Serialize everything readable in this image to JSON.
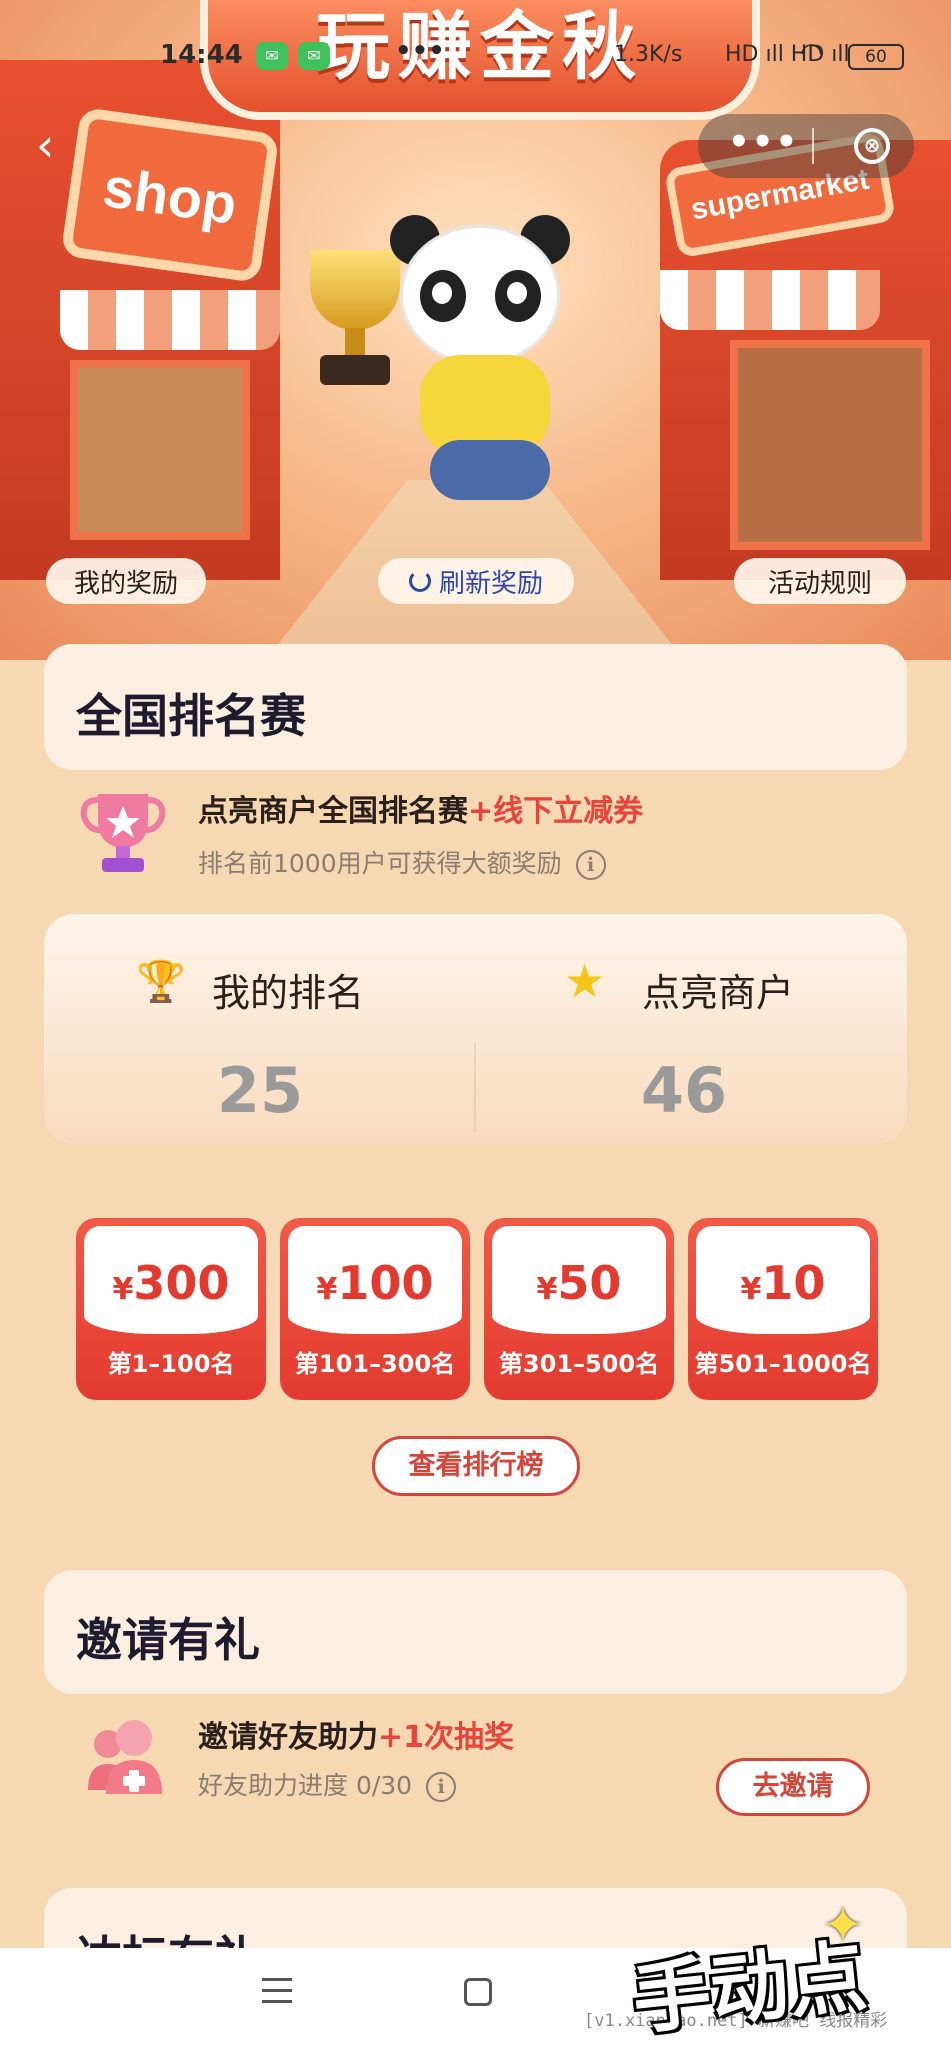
{
  "status_bar": {
    "time": "14:44",
    "more_dots": "•••",
    "net_speed": "1.3K/s",
    "signal": "HD ıll HD ıll",
    "battery": "60"
  },
  "hero": {
    "banner_title": "玩赚金秋",
    "shop_sign_left": "shop",
    "shop_sign_right": "supermarket",
    "my_rewards": "我的奖励",
    "refresh_rewards": "刷新奖励",
    "activity_rules": "活动规则"
  },
  "ranking_section": {
    "title": "全国排名赛",
    "row_main": "点亮商户全国排名赛",
    "row_highlight": "+线下立减券",
    "row_sub": "排名前1000用户可获得大额奖励",
    "my_rank_label": "我的排名",
    "my_rank_value": "25",
    "merchants_label": "点亮商户",
    "merchants_value": "46",
    "rewards": [
      {
        "amount": "300",
        "range": "第1–100名"
      },
      {
        "amount": "100",
        "range": "第101–300名"
      },
      {
        "amount": "50",
        "range": "第301–500名"
      },
      {
        "amount": "10",
        "range": "第501–1000名"
      }
    ],
    "currency": "¥",
    "leaderboard_button": "查看排行榜"
  },
  "invite_section": {
    "title": "邀请有礼",
    "row_main": "邀请好友助力",
    "row_highlight": "+1次抽奖",
    "row_sub": "好友助力进度 0/30",
    "invite_button": "去邀请"
  },
  "next_section": {
    "title_partial": "达标有礼"
  },
  "overlay": {
    "watermark": "[v1.xianbao.net] 新赚吧 线报精彩",
    "sticker_text": "手动点赞"
  },
  "colors": {
    "accent_red": "#e23a2e",
    "background": "#f6d9b3",
    "card": "#fbefe1"
  }
}
